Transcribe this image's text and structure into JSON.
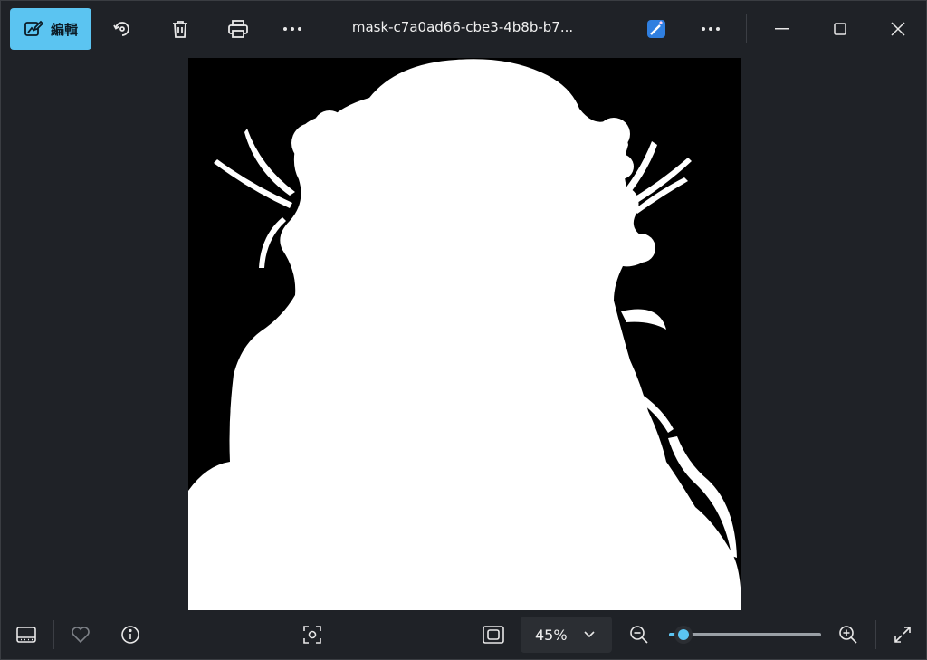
{
  "toolbar": {
    "edit_label": "編輯",
    "file_name": "mask-c7a0ad66-cbe3-4b8b-b7..."
  },
  "viewer": {
    "zoom_label": "45%",
    "zoom_fraction": 0.05
  },
  "colors": {
    "accent": "#5bc4f1",
    "background": "#1f2227",
    "canvas": "#000000",
    "mask": "#ffffff"
  },
  "icons": {
    "edit": "edit-image-icon",
    "rotate": "rotate-icon",
    "delete": "trash-icon",
    "print": "printer-icon",
    "more": "more-icon",
    "designer": "designer-icon",
    "minimize": "minimize-icon",
    "maximize": "maximize-icon",
    "close": "close-icon",
    "filmstrip": "filmstrip-icon",
    "favorite": "heart-icon",
    "info": "info-icon",
    "focus": "focus-icon",
    "fit": "fit-to-window-icon",
    "zoom_out": "zoom-out-icon",
    "zoom_in": "zoom-in-icon",
    "fullscreen": "fullscreen-icon"
  }
}
